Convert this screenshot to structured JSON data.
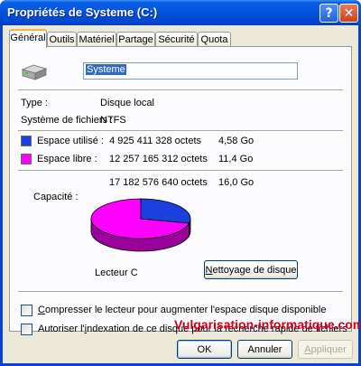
{
  "window": {
    "title": "Propriétés de Systeme (C:)",
    "help_glyph": "?",
    "close_glyph": "✕"
  },
  "tabs": [
    {
      "label": "Général",
      "active": true
    },
    {
      "label": "Outils"
    },
    {
      "label": "Matériel"
    },
    {
      "label": "Partage"
    },
    {
      "label": "Sécurité"
    },
    {
      "label": "Quota"
    }
  ],
  "general": {
    "icon": "hard-drive-icon",
    "volume_name": "Systeme",
    "type_label": "Type :",
    "type_value": "Disque local",
    "fs_label": "Système de fichiers :",
    "fs_value": "NTFS",
    "used_label": "Espace utilisé :",
    "used_bytes": "4 925 411 328 octets",
    "used_size": "4,58 Go",
    "free_label": "Espace libre :",
    "free_bytes": "12 257 165 312 octets",
    "free_size": "11,4 Go",
    "capacity_label": "Capacité :",
    "capacity_bytes": "17 182 576 640 octets",
    "capacity_size": "16,0 Go",
    "drive_label": "Lecteur C",
    "cleanup_pre": "",
    "cleanup_ul": "N",
    "cleanup_post": "ettoyage de disque",
    "compress_pre": "",
    "compress_ul": "C",
    "compress_post": "ompresser le lecteur pour augmenter l'espace disque disponible",
    "compress_checked": false,
    "index_pre": "Autoriser l'",
    "index_ul": "i",
    "index_post": "ndexation de ce disque pour la recherche rapide de fichiers",
    "index_checked": false,
    "used_fraction": 0.2866,
    "colors": {
      "used": "#1c3fe0",
      "free": "#ff00ff"
    }
  },
  "watermark": "Vulgarisation-informatique.com",
  "buttons": {
    "ok": "OK",
    "cancel": "Annuler",
    "apply_pre": "",
    "apply_ul": "A",
    "apply_post": "ppliquer",
    "apply_enabled": false
  }
}
